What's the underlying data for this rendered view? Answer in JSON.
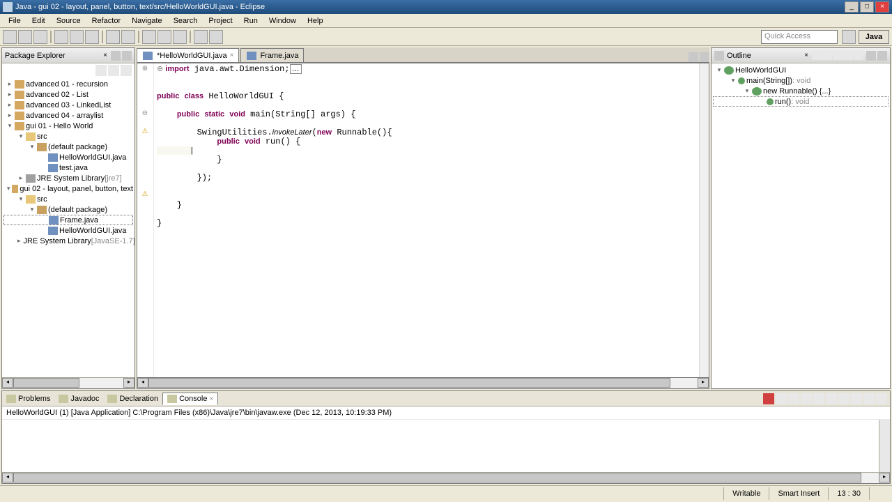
{
  "window": {
    "title": "Java - gui 02 - layout, panel, button, text/src/HelloWorldGUI.java - Eclipse"
  },
  "menu": {
    "file": "File",
    "edit": "Edit",
    "source": "Source",
    "refactor": "Refactor",
    "navigate": "Navigate",
    "search": "Search",
    "project": "Project",
    "run": "Run",
    "window": "Window",
    "help": "Help"
  },
  "quick_access": "Quick Access",
  "perspective": {
    "java": "Java"
  },
  "package_explorer": {
    "title": "Package Explorer",
    "projects": [
      {
        "label": "advanced 01 - recursion"
      },
      {
        "label": "advanced 02 - List"
      },
      {
        "label": "advanced 03 - LinkedList"
      },
      {
        "label": "advanced 04 - arraylist"
      },
      {
        "label": "gui 01 - Hello World",
        "expanded": true,
        "children": [
          {
            "label": "src",
            "type": "folder",
            "expanded": true,
            "children": [
              {
                "label": "(default package)",
                "type": "pkg",
                "expanded": true,
                "children": [
                  {
                    "label": "HelloWorldGUI.java",
                    "type": "java"
                  },
                  {
                    "label": "test.java",
                    "type": "java"
                  }
                ]
              }
            ]
          },
          {
            "label": "JRE System Library",
            "suffix": " [jre7]",
            "type": "lib"
          }
        ]
      },
      {
        "label": "gui 02 - layout, panel, button, text",
        "expanded": true,
        "children": [
          {
            "label": "src",
            "type": "folder",
            "expanded": true,
            "children": [
              {
                "label": "(default package)",
                "type": "pkg",
                "expanded": true,
                "children": [
                  {
                    "label": "Frame.java",
                    "type": "java",
                    "selected": true
                  },
                  {
                    "label": "HelloWorldGUI.java",
                    "type": "java"
                  }
                ]
              }
            ]
          },
          {
            "label": "JRE System Library",
            "suffix": " [JavaSE-1.7]",
            "type": "lib"
          }
        ]
      }
    ]
  },
  "editor": {
    "tabs": [
      {
        "label": "*HelloWorldGUI.java",
        "active": true
      },
      {
        "label": "Frame.java",
        "active": false
      }
    ],
    "import_line": "import java.awt.Dimension;",
    "code": {
      "l1": "public class HelloWorldGUI {",
      "l2": "    public static void main(String[] args) {",
      "l3": "        SwingUtilities.invokeLater(new Runnable(){",
      "l4": "            public void run() {",
      "l5": "                ",
      "l6": "            }",
      "l7": "            ",
      "l8": "        });",
      "l9": "        ",
      "l10": "        ",
      "l11": "    }",
      "l12": "",
      "l13": "}"
    }
  },
  "outline": {
    "title": "Outline",
    "root": "HelloWorldGUI",
    "main": "main(String[]) : void",
    "runnable": "new Runnable() {...}",
    "run": "run() : void"
  },
  "bottom": {
    "tabs": {
      "problems": "Problems",
      "javadoc": "Javadoc",
      "declaration": "Declaration",
      "console": "Console"
    },
    "console_info": "HelloWorldGUI (1) [Java Application] C:\\Program Files (x86)\\Java\\jre7\\bin\\javaw.exe (Dec 12, 2013, 10:19:33 PM)"
  },
  "status": {
    "writable": "Writable",
    "insert": "Smart Insert",
    "pos": "13 : 30"
  }
}
